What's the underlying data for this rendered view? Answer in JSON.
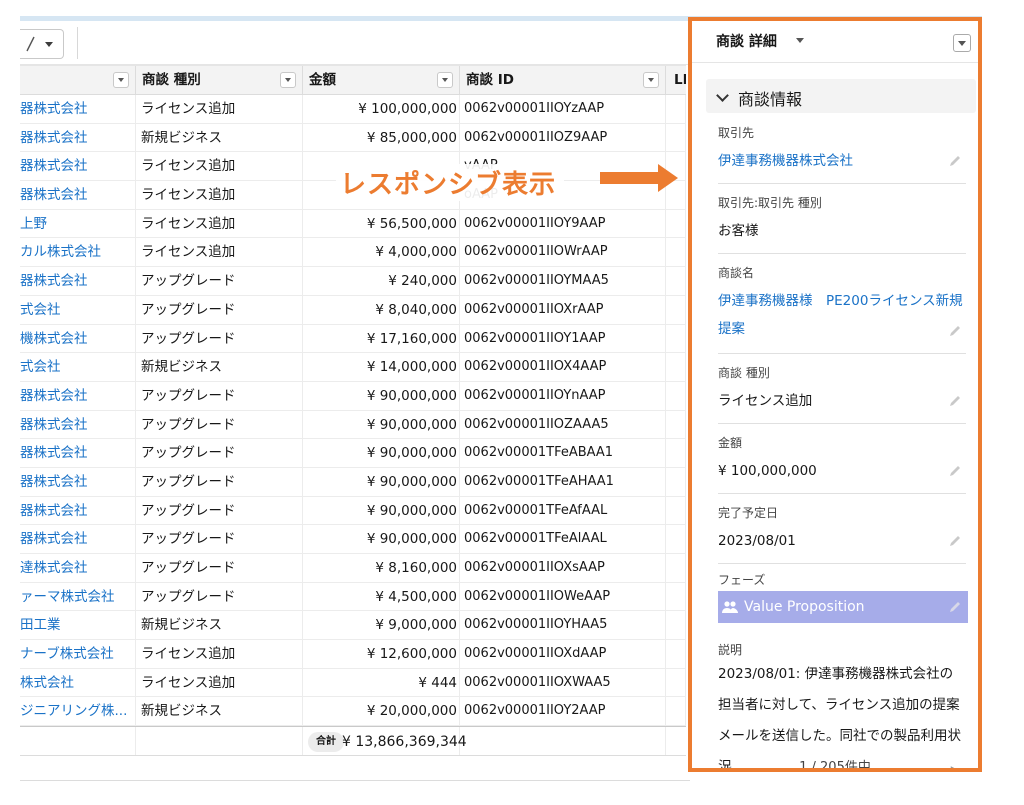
{
  "table": {
    "columns": [
      {
        "key": "account",
        "label": ""
      },
      {
        "key": "type",
        "label": "商談 種別"
      },
      {
        "key": "amount",
        "label": "金額"
      },
      {
        "key": "id",
        "label": "商談 ID"
      },
      {
        "key": "le",
        "label": "LE"
      }
    ],
    "rows": [
      {
        "account": "器株式会社",
        "type": "ライセンス追加",
        "amount": "¥ 100,000,000",
        "id": "0062v00001IIOYzAAP"
      },
      {
        "account": "器株式会社",
        "type": "新規ビジネス",
        "amount": "¥ 85,000,000",
        "id": "0062v00001IIOZ9AAP"
      },
      {
        "account": "器株式会社",
        "type": "ライセンス追加",
        "amount": "",
        "id": "vAAP"
      },
      {
        "account": "器株式会社",
        "type": "ライセンス追加",
        "amount": "",
        "id": "oAAP"
      },
      {
        "account": "上野",
        "type": "ライセンス追加",
        "amount": "¥ 56,500,000",
        "id": "0062v00001IIOY9AAP"
      },
      {
        "account": "カル株式会社",
        "type": "ライセンス追加",
        "amount": "¥ 4,000,000",
        "id": "0062v00001IIOWrAAP"
      },
      {
        "account": "器株式会社",
        "type": "アップグレード",
        "amount": "¥ 240,000",
        "id": "0062v00001IIOYMAA5"
      },
      {
        "account": "式会社",
        "type": "アップグレード",
        "amount": "¥ 8,040,000",
        "id": "0062v00001IIOXrAAP"
      },
      {
        "account": "機株式会社",
        "type": "アップグレード",
        "amount": "¥ 17,160,000",
        "id": "0062v00001IIOY1AAP"
      },
      {
        "account": "式会社",
        "type": "新規ビジネス",
        "amount": "¥ 14,000,000",
        "id": "0062v00001IIOX4AAP"
      },
      {
        "account": "器株式会社",
        "type": "アップグレード",
        "amount": "¥ 90,000,000",
        "id": "0062v00001IIOYnAAP"
      },
      {
        "account": "器株式会社",
        "type": "アップグレード",
        "amount": "¥ 90,000,000",
        "id": "0062v00001IIOZAAA5"
      },
      {
        "account": "器株式会社",
        "type": "アップグレード",
        "amount": "¥ 90,000,000",
        "id": "0062v00001TFeABAA1"
      },
      {
        "account": "器株式会社",
        "type": "アップグレード",
        "amount": "¥ 90,000,000",
        "id": "0062v00001TFeAHAA1"
      },
      {
        "account": "器株式会社",
        "type": "アップグレード",
        "amount": "¥ 90,000,000",
        "id": "0062v00001TFeAfAAL"
      },
      {
        "account": "器株式会社",
        "type": "アップグレード",
        "amount": "¥ 90,000,000",
        "id": "0062v00001TFeAlAAL"
      },
      {
        "account": "達株式会社",
        "type": "アップグレード",
        "amount": "¥ 8,160,000",
        "id": "0062v00001IIOXsAAP"
      },
      {
        "account": "ァーマ株式会社",
        "type": "アップグレード",
        "amount": "¥ 4,500,000",
        "id": "0062v00001IIOWeAAP"
      },
      {
        "account": "田工業",
        "type": "新規ビジネス",
        "amount": "¥ 9,000,000",
        "id": "0062v00001IIOYHAA5"
      },
      {
        "account": "ナーブ株式会社",
        "type": "ライセンス追加",
        "amount": "¥ 12,600,000",
        "id": "0062v00001IIOXdAAP"
      },
      {
        "account": "株式会社",
        "type": "ライセンス追加",
        "amount": "¥ 444",
        "id": "0062v00001IIOXWAA5"
      },
      {
        "account": "ジニアリング株...",
        "type": "新規ビジネス",
        "amount": "¥ 20,000,000",
        "id": "0062v00001IIOY2AAP"
      }
    ],
    "sum_label": "合計",
    "sum_value": "¥ 13,866,369,344"
  },
  "annotation": {
    "text": "レスポンシブ表示",
    "color": "#ec7c30"
  },
  "panel": {
    "title": "商談 詳細",
    "section_title": "商談情報",
    "fields": [
      {
        "label": "取引先",
        "value": "伊達事務機器株式会社",
        "link": true
      },
      {
        "label": "取引先:取引先 種別",
        "value": "お客様",
        "link": false
      },
      {
        "label": "商談名",
        "value": "伊達事務機器様　PE200ライセンス新規提案",
        "link": true
      },
      {
        "label": "商談 種別",
        "value": "ライセンス追加",
        "link": false
      },
      {
        "label": "金額",
        "value": "¥ 100,000,000",
        "link": false
      },
      {
        "label": "完了予定日",
        "value": "2023/08/01",
        "link": false
      }
    ],
    "phase": {
      "label": "フェーズ",
      "value": "Value Proposition",
      "color": "#a6ace9"
    },
    "description": {
      "label": "説明",
      "value": "2023/08/01: 伊達事務機器株式会社の担当者に対して、ライセンス追加の提案メールを送信した。同社での製品利用状況"
    },
    "pager": "1 / 205件中"
  }
}
